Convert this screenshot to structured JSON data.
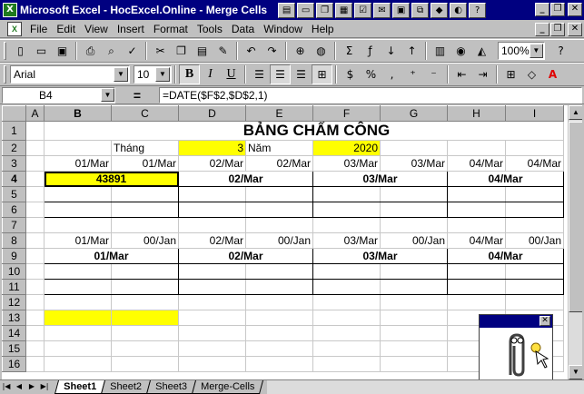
{
  "window": {
    "title": "Microsoft Excel - HocExcel.Online - Merge Cells",
    "app_icon": "excel-icon"
  },
  "menu": [
    "File",
    "Edit",
    "View",
    "Insert",
    "Format",
    "Tools",
    "Data",
    "Window",
    "Help"
  ],
  "toolbar": {
    "zoom": "100%",
    "font": "Arial",
    "size": "10"
  },
  "formula_bar": {
    "cell": "B4",
    "equals": "=",
    "formula": "=DATE($F$2,$D$2,1)"
  },
  "columns": [
    "A",
    "B",
    "C",
    "D",
    "E",
    "F",
    "G",
    "H",
    "I"
  ],
  "rows": [
    "1",
    "2",
    "3",
    "4",
    "5",
    "6",
    "7",
    "8",
    "9",
    "10",
    "11",
    "12",
    "13",
    "14",
    "15",
    "16"
  ],
  "cells": {
    "title": "BẢNG CHẤM CÔNG",
    "month_label": "Tháng",
    "month_value": "3",
    "year_label": "Năm",
    "year_value": "2020",
    "r3": [
      "01/Mar",
      "01/Mar",
      "02/Mar",
      "02/Mar",
      "03/Mar",
      "03/Mar",
      "04/Mar",
      "04/Mar"
    ],
    "r4": [
      "43891",
      "02/Mar",
      "03/Mar",
      "04/Mar"
    ],
    "r8": [
      "01/Mar",
      "00/Jan",
      "02/Mar",
      "00/Jan",
      "03/Mar",
      "00/Jan",
      "04/Mar",
      "00/Jan"
    ],
    "r9": [
      "01/Mar",
      "02/Mar",
      "03/Mar",
      "04/Mar"
    ]
  },
  "sheets": [
    "Sheet1",
    "Sheet2",
    "Sheet3",
    "Merge-Cells"
  ],
  "colors": {
    "title_bg": "#000080",
    "highlight": "#ffff00"
  }
}
